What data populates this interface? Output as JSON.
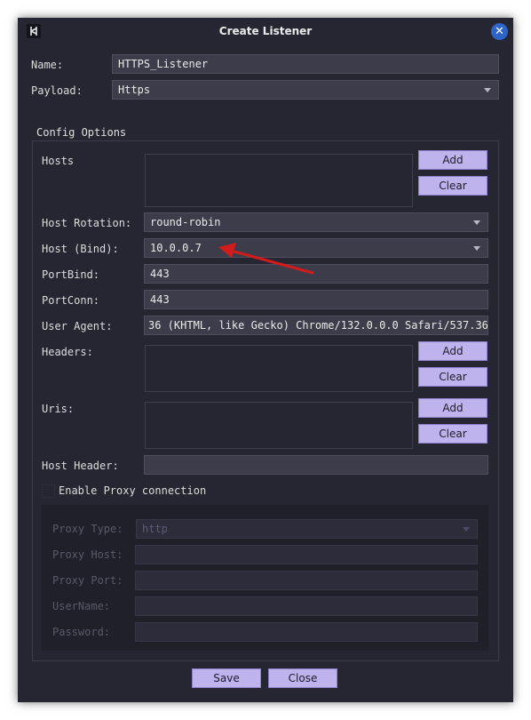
{
  "window": {
    "title": "Create Listener"
  },
  "name_field": {
    "label": "Name:",
    "value": "HTTPS_Listener"
  },
  "payload_field": {
    "label": "Payload:",
    "value": "Https"
  },
  "config": {
    "title": "Config Options",
    "hosts_label": "Hosts",
    "host_rotation": {
      "label": "Host Rotation:",
      "value": "round-robin"
    },
    "host_bind": {
      "label": "Host (Bind):",
      "value": "10.0.0.7"
    },
    "port_bind": {
      "label": "PortBind:",
      "value": "443"
    },
    "port_conn": {
      "label": "PortConn:",
      "value": "443"
    },
    "user_agent": {
      "label": "User Agent:",
      "value": "36 (KHTML, like Gecko) Chrome/132.0.0.0 Safari/537.36"
    },
    "headers_label": "Headers:",
    "uris_label": "Uris:",
    "host_header": {
      "label": "Host Header:",
      "value": ""
    },
    "add_label": "Add",
    "clear_label": "Clear",
    "proxy_checkbox_label": "Enable Proxy connection",
    "proxy": {
      "type_label": "Proxy Type:",
      "type_value": "http",
      "host_label": "Proxy Host:",
      "port_label": "Proxy Port:",
      "username_label": "UserName:",
      "password_label": "Password:"
    }
  },
  "footer": {
    "save_label": "Save",
    "close_label": "Close"
  },
  "colors": {
    "window_bg": "#262633",
    "button_bg": "#bfb3ee",
    "annotation_arrow": "#d01c1c",
    "close_button": "#2e64c8"
  }
}
